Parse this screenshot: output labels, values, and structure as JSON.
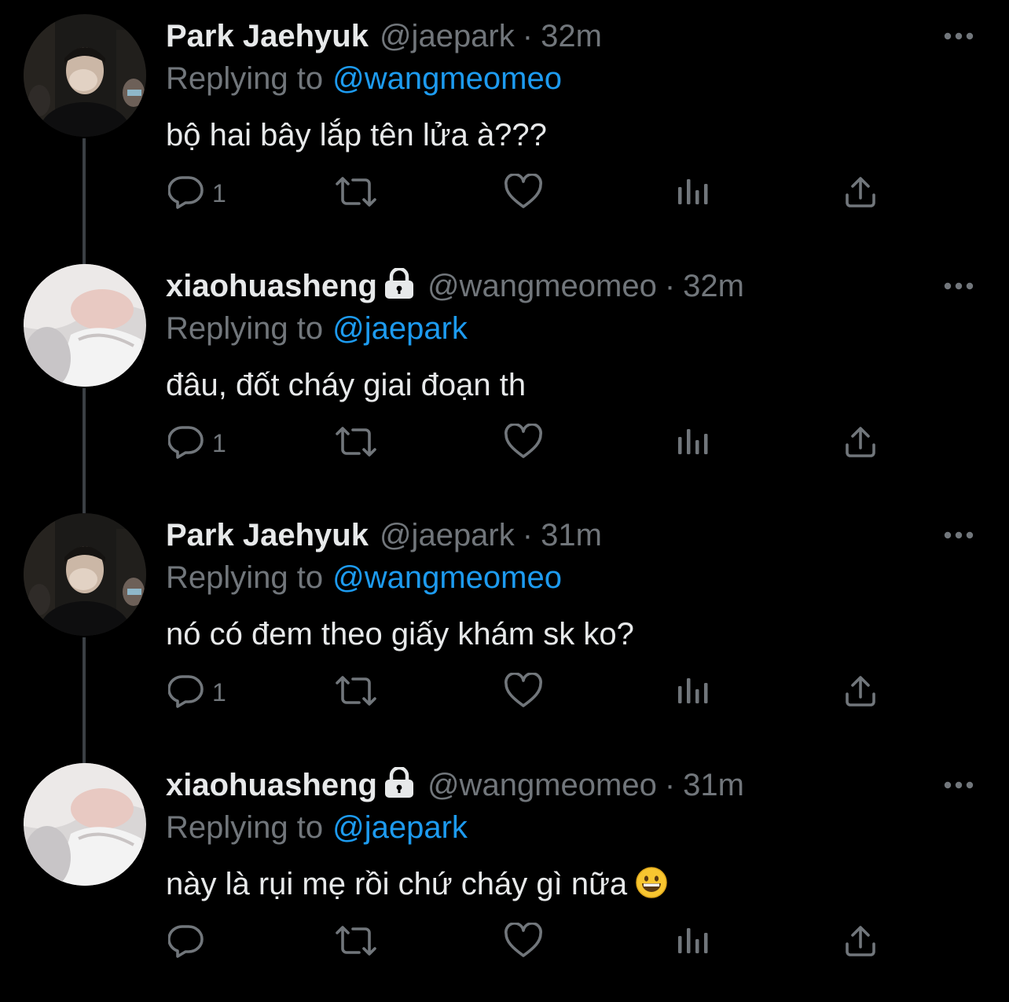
{
  "tweets": [
    {
      "name": "Park Jaehyuk",
      "locked": false,
      "handle": "@jaepark",
      "separator": "·",
      "time": "32m",
      "replying_label": "Replying to",
      "replying_to": "@wangmeomeo",
      "text": "bộ hai bây lắp tên lửa à???",
      "reply_count": "1",
      "avatar": "dark-photo-avatar"
    },
    {
      "name": "xiaohuasheng",
      "locked": true,
      "handle": "@wangmeomeo",
      "separator": "·",
      "time": "32m",
      "replying_label": "Replying to",
      "replying_to": "@jaepark",
      "text": "đâu, đốt cháy giai đoạn th",
      "reply_count": "1",
      "avatar": "light-photo-avatar"
    },
    {
      "name": "Park Jaehyuk",
      "locked": false,
      "handle": "@jaepark",
      "separator": "·",
      "time": "31m",
      "replying_label": "Replying to",
      "replying_to": "@wangmeomeo",
      "text": "nó có đem theo giấy khám sk ko?",
      "reply_count": "1",
      "avatar": "dark-photo-avatar"
    },
    {
      "name": "xiaohuasheng",
      "locked": true,
      "handle": "@wangmeomeo",
      "separator": "·",
      "time": "31m",
      "replying_label": "Replying to",
      "replying_to": "@jaepark",
      "text": "này là rụi mẹ rồi chứ cháy gì nữa",
      "emoji": "grinning-face-emoji",
      "reply_count": "",
      "avatar": "light-photo-avatar"
    }
  ],
  "icons": {
    "reply": "reply-icon",
    "retweet": "retweet-icon",
    "like": "like-icon",
    "analytics": "analytics-icon",
    "share": "share-icon",
    "more": "more-icon",
    "lock": "lock-icon"
  },
  "colors": {
    "background": "#000000",
    "text": "#e7e9ea",
    "secondary": "#71767b",
    "link": "#1d9bf0",
    "thread_line": "#3b4045"
  }
}
